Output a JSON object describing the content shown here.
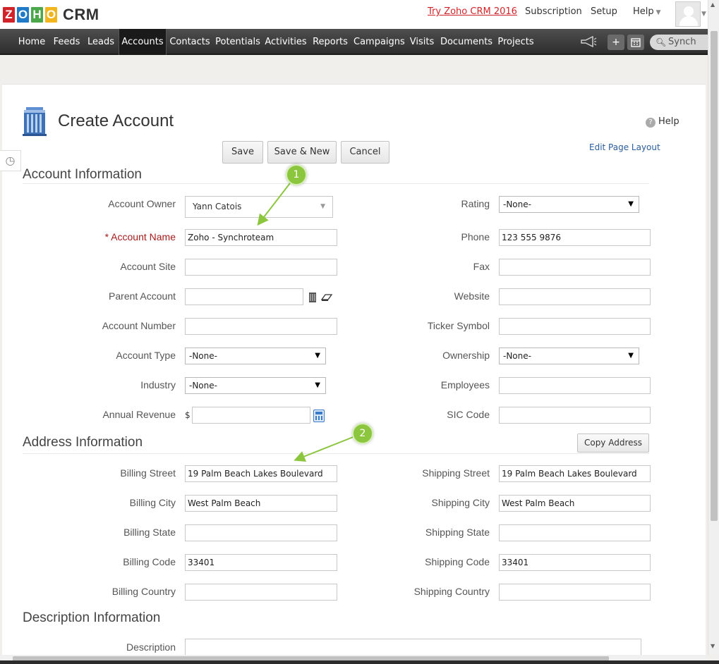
{
  "brand": {
    "logo_letters": [
      "Z",
      "O",
      "H",
      "O"
    ],
    "logo_colors": [
      "#d2232a",
      "#1f7ac8",
      "#4aa84a",
      "#f2b51d"
    ],
    "product": "CRM"
  },
  "topbar": {
    "try_link": "Try Zoho CRM 2016",
    "subscription": "Subscription",
    "setup": "Setup",
    "help": "Help"
  },
  "nav": {
    "items": [
      "Home",
      "Feeds",
      "Leads",
      "Accounts",
      "Contacts",
      "Potentials",
      "Activities",
      "Reports",
      "Campaigns",
      "Visits",
      "Documents",
      "Projects"
    ],
    "active": "Accounts",
    "search_value": "Synch"
  },
  "page": {
    "title": "Create Account",
    "help": "Help",
    "edit_layout": "Edit Page Layout",
    "buttons": {
      "save": "Save",
      "save_new": "Save & New",
      "cancel": "Cancel"
    }
  },
  "sections": {
    "account": "Account Information",
    "address": "Address Information",
    "description": "Description Information"
  },
  "account_info": {
    "owner_label": "Account Owner",
    "owner_value": "Yann Catois",
    "name_label": "* Account Name",
    "name_value": "Zoho - Synchroteam",
    "site_label": "Account Site",
    "site_value": "",
    "parent_label": "Parent Account",
    "parent_value": "",
    "number_label": "Account Number",
    "number_value": "",
    "type_label": "Account Type",
    "type_value": "-None-",
    "industry_label": "Industry",
    "industry_value": "-None-",
    "revenue_label": "Annual Revenue",
    "revenue_currency": "$",
    "revenue_value": "",
    "rating_label": "Rating",
    "rating_value": "-None-",
    "phone_label": "Phone",
    "phone_value": "123 555 9876",
    "fax_label": "Fax",
    "fax_value": "",
    "website_label": "Website",
    "website_value": "",
    "ticker_label": "Ticker Symbol",
    "ticker_value": "",
    "ownership_label": "Ownership",
    "ownership_value": "-None-",
    "employees_label": "Employees",
    "employees_value": "",
    "sic_label": "SIC Code",
    "sic_value": ""
  },
  "address_info": {
    "copy_button": "Copy Address",
    "billing_street_label": "Billing Street",
    "billing_street_value": "19 Palm Beach Lakes Boulevard",
    "billing_city_label": "Billing City",
    "billing_city_value": "West Palm Beach",
    "billing_state_label": "Billing State",
    "billing_state_value": "",
    "billing_code_label": "Billing Code",
    "billing_code_value": "33401",
    "billing_country_label": "Billing Country",
    "billing_country_value": "",
    "shipping_street_label": "Shipping Street",
    "shipping_street_value": "19 Palm Beach Lakes Boulevard",
    "shipping_city_label": "Shipping City",
    "shipping_city_value": "West Palm Beach",
    "shipping_state_label": "Shipping State",
    "shipping_state_value": "",
    "shipping_code_label": "Shipping Code",
    "shipping_code_value": "33401",
    "shipping_country_label": "Shipping Country",
    "shipping_country_value": ""
  },
  "description_info": {
    "description_label": "Description",
    "description_value": ""
  },
  "callouts": [
    "1",
    "2"
  ],
  "icons": {
    "history": "clock-icon",
    "lookup": "building-lookup-icon",
    "clear": "eraser-icon",
    "calculator": "calculator-icon",
    "help": "question-icon",
    "page": "account-building-icon",
    "megaphone": "megaphone-icon",
    "add": "plus-icon",
    "calendar": "calendar-icon",
    "search": "search-icon"
  }
}
